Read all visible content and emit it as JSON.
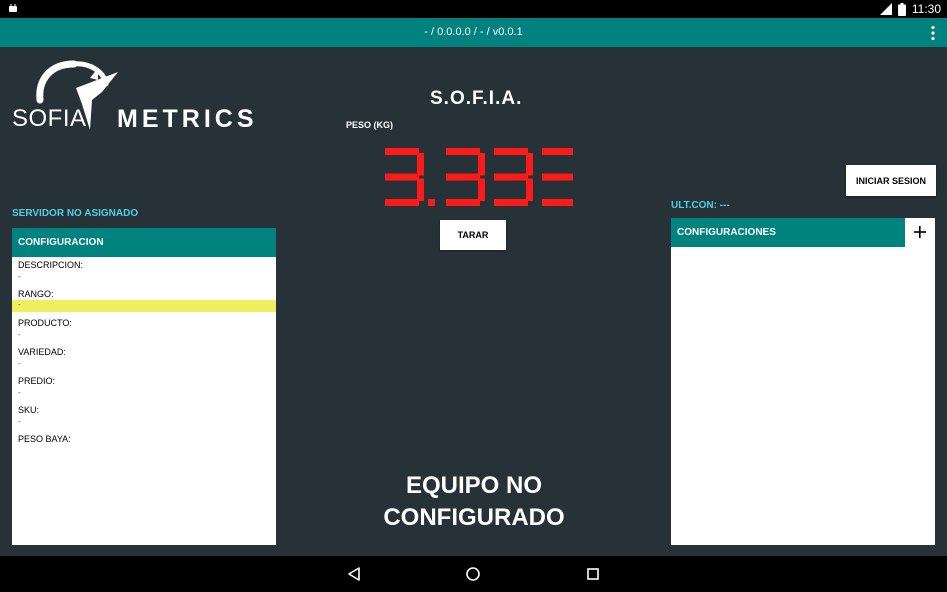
{
  "status_bar": {
    "time": "11:30",
    "network": "LTE"
  },
  "action_bar": {
    "title": "- / 0.0.0.0 / - / v0.0.1",
    "menu_icon": "overflow-menu-icon"
  },
  "logo": {
    "word1": "SOFIA",
    "word2": "METRICS"
  },
  "server_status": "SERVIDOR NO ASIGNADO",
  "config_panel": {
    "title": "CONFIGURACION",
    "items": [
      {
        "label": "DESCRIPCION:",
        "value": "-"
      },
      {
        "label": "RANGO:",
        "value": "-"
      },
      {
        "label": "PRODUCTO:",
        "value": "-"
      },
      {
        "label": "VARIEDAD:",
        "value": "-"
      },
      {
        "label": "PREDIO:",
        "value": "-"
      },
      {
        "label": "SKU:",
        "value": "-"
      },
      {
        "label": "PESO BAYA:",
        "value": ""
      }
    ]
  },
  "app_title": "S.O.F.I.A.",
  "weight": {
    "label": "PESO (KG)",
    "value": "3.333",
    "color": "#FF1A1A"
  },
  "buttons": {
    "tare": "TARAR",
    "login": "INICIAR SESION"
  },
  "last_connection": "ULT.CON: ---",
  "configs_panel": {
    "title": "CONFIGURACIONES",
    "add_icon": "plus-icon"
  },
  "message": {
    "line1": "EQUIPO NO",
    "line2": "CONFIGURADO"
  },
  "colors": {
    "accent": "#00827F",
    "background": "#263238",
    "info_text": "#4DD0E1",
    "highlight": "#EEF060"
  }
}
